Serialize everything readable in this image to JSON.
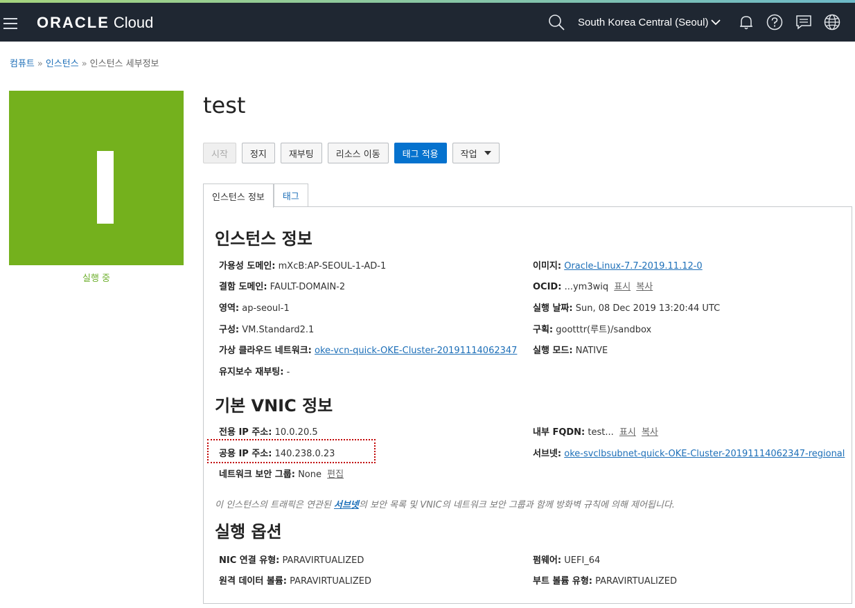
{
  "header": {
    "brand": "ORACLE",
    "product": "Cloud",
    "region": "South Korea Central (Seoul)"
  },
  "icons": [
    "menu-icon",
    "search-icon",
    "chevron-down-icon",
    "bell-icon",
    "help-icon",
    "chat-icon",
    "globe-icon"
  ],
  "breadcrumb": {
    "items": [
      "컴퓨트",
      "인스턴스",
      "인스턴스 세부정보"
    ],
    "separator": "»"
  },
  "status_tile": {
    "letter": "I",
    "status": "실행 중",
    "color": "#74b11d"
  },
  "page_title": "test",
  "actions": {
    "start": "시작",
    "stop": "정지",
    "reboot": "재부팅",
    "move": "리소스 이동",
    "tag": "태그 적용",
    "more": "작업"
  },
  "tabs": [
    "인스턴스 정보",
    "태그"
  ],
  "instance_info": {
    "heading": "인스턴스 정보",
    "ad_label": "가용성 도메인:",
    "ad_value": "mXcB:AP-SEOUL-1-AD-1",
    "fd_label": "결함 도메인:",
    "fd_value": "FAULT-DOMAIN-2",
    "region_label": "영역:",
    "region_value": "ap-seoul-1",
    "shape_label": "구성:",
    "shape_value": "VM.Standard2.1",
    "vcn_label": "가상 클라우드 네트워크:",
    "vcn_value": "oke-vcn-quick-OKE-Cluster-20191114062347",
    "maint_label": "유지보수 재부팅:",
    "maint_value": "-",
    "image_label": "이미지:",
    "image_value": "Oracle-Linux-7.7-2019.11.12-0",
    "ocid_label": "OCID:",
    "ocid_value": "...ym3wiq",
    "show": "표시",
    "copy": "복사",
    "launched_label": "실행 날짜:",
    "launched_value": "Sun, 08 Dec 2019 13:20:44 UTC",
    "compartment_label": "구획:",
    "compartment_value": "gootttr(루트)/sandbox",
    "mode_label": "실행 모드:",
    "mode_value": "NATIVE"
  },
  "vnic_info": {
    "heading": "기본 VNIC 정보",
    "private_ip_label": "전용 IP 주소:",
    "private_ip_value": "10.0.20.5",
    "public_ip_label": "공용 IP 주소:",
    "public_ip_value": "140.238.0.23",
    "nsg_label": "네트워크 보안 그룹:",
    "nsg_value": "None",
    "nsg_edit": "편집",
    "fqdn_label": "내부 FQDN:",
    "fqdn_value": "test...",
    "show": "표시",
    "copy": "복사",
    "subnet_label": "서브넷:",
    "subnet_value": "oke-svclbsubnet-quick-OKE-Cluster-20191114062347-regional",
    "note_before": "이 인스턴스의 트래픽은 연관된 ",
    "note_link": "서브넷",
    "note_after": "의 보안 목록 및 VNIC의 네트워크 보안 그룹과 함께 방화벽 규칙에 의해 제어됩니다."
  },
  "launch_options": {
    "heading": "실행 옵션",
    "nic_label": "NIC 연결 유형:",
    "nic_value": "PARAVIRTUALIZED",
    "remote_label": "원격 데이터 볼륨:",
    "remote_value": "PARAVIRTUALIZED",
    "firmware_label": "펌웨어:",
    "firmware_value": "UEFI_64",
    "boot_label": "부트 볼륨 유형:",
    "boot_value": "PARAVIRTUALIZED"
  }
}
